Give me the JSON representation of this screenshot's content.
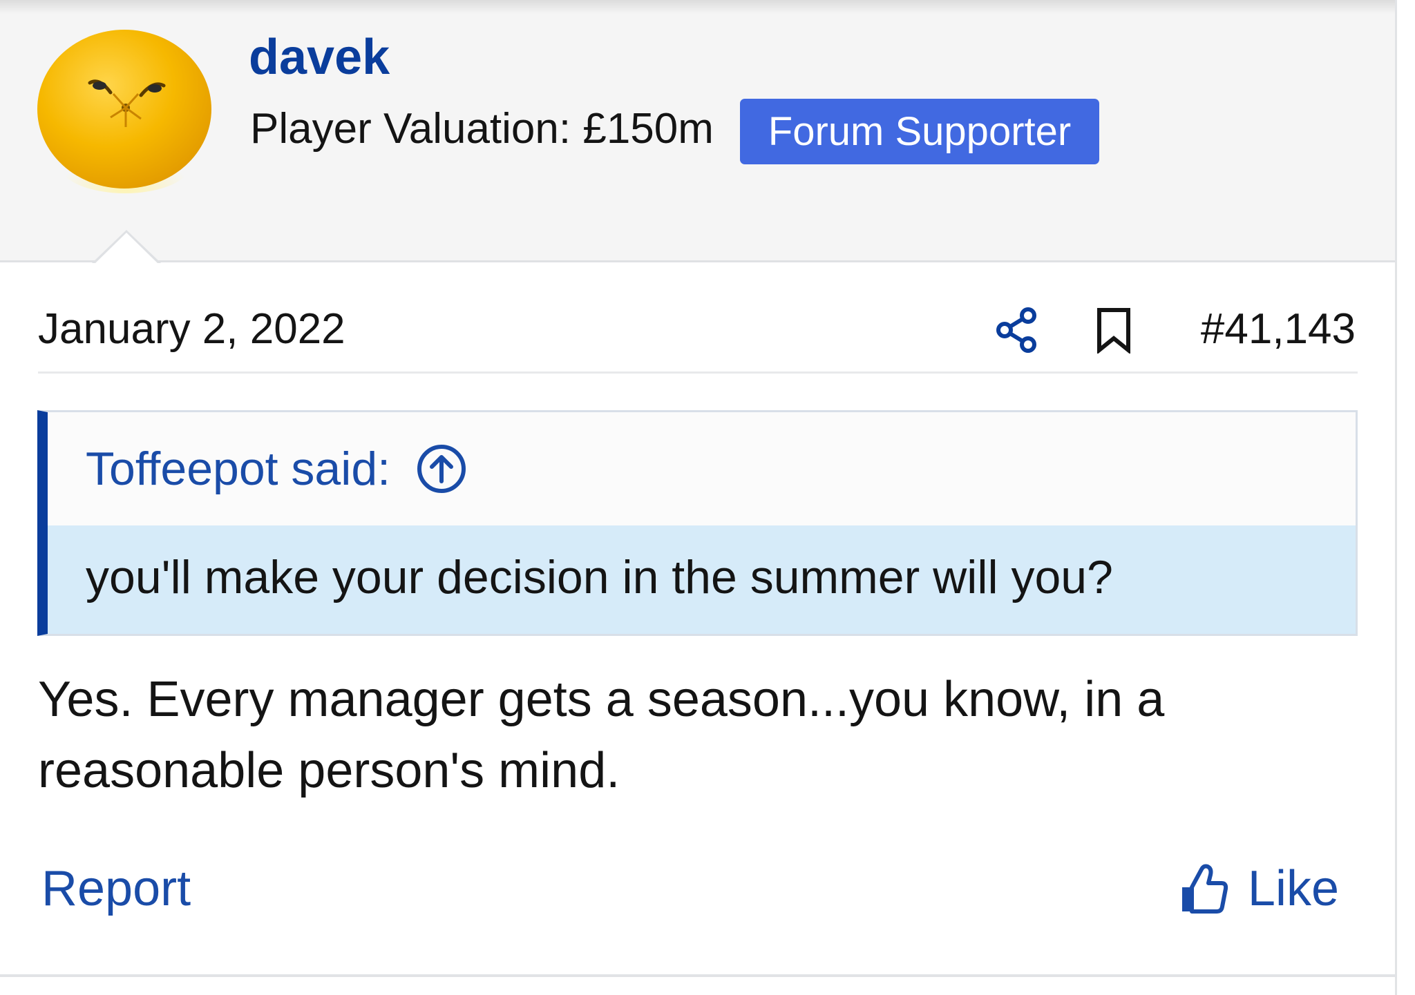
{
  "user": {
    "username": "davek",
    "valuation": "Player Valuation: £150m",
    "badge": "Forum Supporter"
  },
  "meta": {
    "date": "January 2, 2022",
    "post_number": "#41,143"
  },
  "quote": {
    "author_label": "Toffeepot said:",
    "text": "you'll make your decision in the summer will you?"
  },
  "message": {
    "text": "Yes. Every manager gets a season...you know, in a reasonable person's mind."
  },
  "actions": {
    "report_label": "Report",
    "like_label": "Like"
  },
  "icons": {
    "share": "share-icon",
    "bookmark": "bookmark-icon",
    "jump_to_quote": "arrow-up-circle-icon",
    "like": "thumbs-up-icon",
    "avatar": "orange-face-avatar"
  },
  "colors": {
    "link": "#1a4ca8",
    "username": "#0a3d9c",
    "badge_bg": "#4169e1",
    "quote_border": "#0a3d9c",
    "quote_body_bg": "#d6ebf9",
    "header_bg": "#f5f5f5"
  }
}
